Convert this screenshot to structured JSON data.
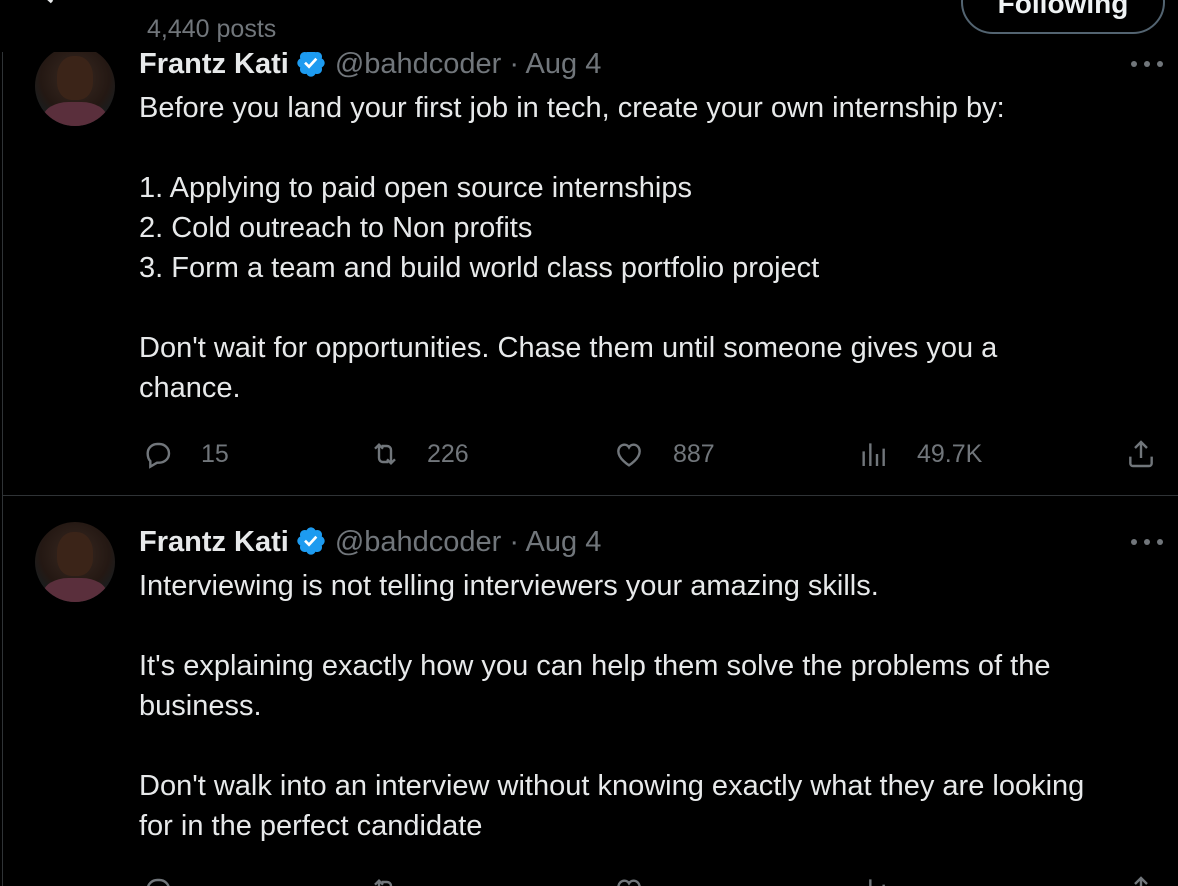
{
  "header": {
    "posts_count": "4,440 posts",
    "following_label": "Following"
  },
  "tweets": [
    {
      "display_name": "Frantz Kati",
      "handle": "@bahdcoder",
      "separator": "·",
      "date": "Aug 4",
      "lines": [
        "Before you land your first job in tech, create your own internship by:",
        "",
        "1. Applying to paid open source internships",
        "2. Cold outreach to Non profits",
        "3. Form a team and build world class portfolio project",
        "",
        "Don't wait for opportunities. Chase them until someone gives you a",
        "chance."
      ],
      "replies": "15",
      "reposts": "226",
      "likes": "887",
      "views": "49.7K"
    },
    {
      "display_name": "Frantz Kati",
      "handle": "@bahdcoder",
      "separator": "·",
      "date": "Aug 4",
      "lines": [
        "Interviewing is not telling interviewers your amazing skills.",
        "",
        "It's explaining exactly how you can help them solve the problems of the",
        "business.",
        "",
        "Don't walk into an interview without knowing exactly what they are looking",
        "for in the perfect candidate"
      ]
    }
  ],
  "colors": {
    "background": "#000000",
    "text_primary": "#e7e9ea",
    "text_secondary": "#71767b",
    "border": "#2f3336",
    "verified_blue": "#1d9bf0"
  },
  "icons": {
    "back": "back-arrow-icon",
    "verified": "verified-badge-icon",
    "more": "more-icon",
    "reply": "reply-icon",
    "repost": "repost-icon",
    "like": "like-icon",
    "views": "views-icon",
    "share": "share-icon"
  }
}
